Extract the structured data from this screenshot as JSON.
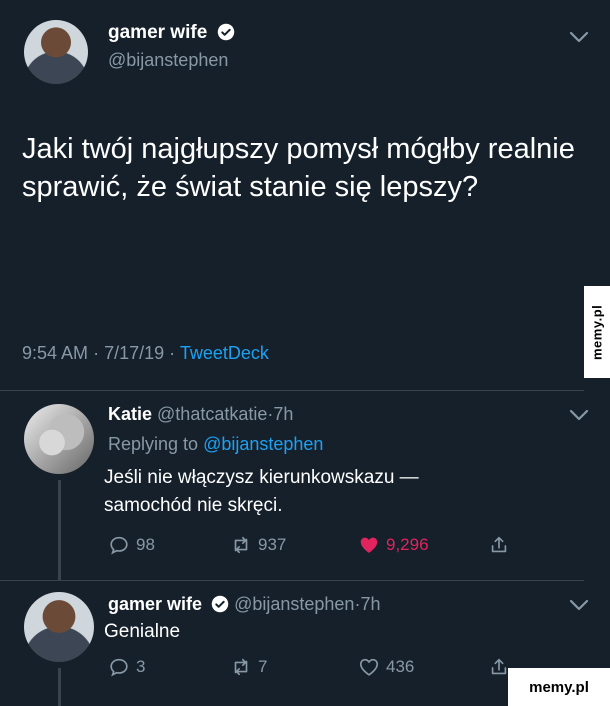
{
  "main_tweet": {
    "display_name": "gamer wife",
    "handle": "@bijanstephen",
    "text": "Jaki twój najgłupszy pomysł mógłby realnie sprawić, że świat stanie się lepszy?",
    "time": "9:54 AM",
    "date": "7/17/19",
    "source": "TweetDeck",
    "separator": "·"
  },
  "reply1": {
    "display_name": "Katie",
    "handle": "@thatcatkatie",
    "age": "7h",
    "replying_to_label": "Replying to",
    "replying_to_handle": "@bijanstephen",
    "text": "Jeśli nie włączysz kierunkowskazu — samochód nie skręci.",
    "replies": "98",
    "retweets": "937",
    "likes": "9,296",
    "liked": true
  },
  "reply2": {
    "display_name": "gamer wife",
    "handle": "@bijanstephen",
    "age": "7h",
    "text": "Genialne",
    "replies": "3",
    "retweets": "7",
    "likes": "436"
  },
  "watermarks": {
    "side": "memy.pl",
    "corner": "memy.pl"
  },
  "colors": {
    "background": "#15202b",
    "muted": "#8899a6",
    "link": "#1da1f2",
    "like": "#e0245e"
  },
  "icons": [
    "chevron-down-icon",
    "verified-badge-icon",
    "reply-icon",
    "retweet-icon",
    "heart-icon",
    "share-icon"
  ]
}
